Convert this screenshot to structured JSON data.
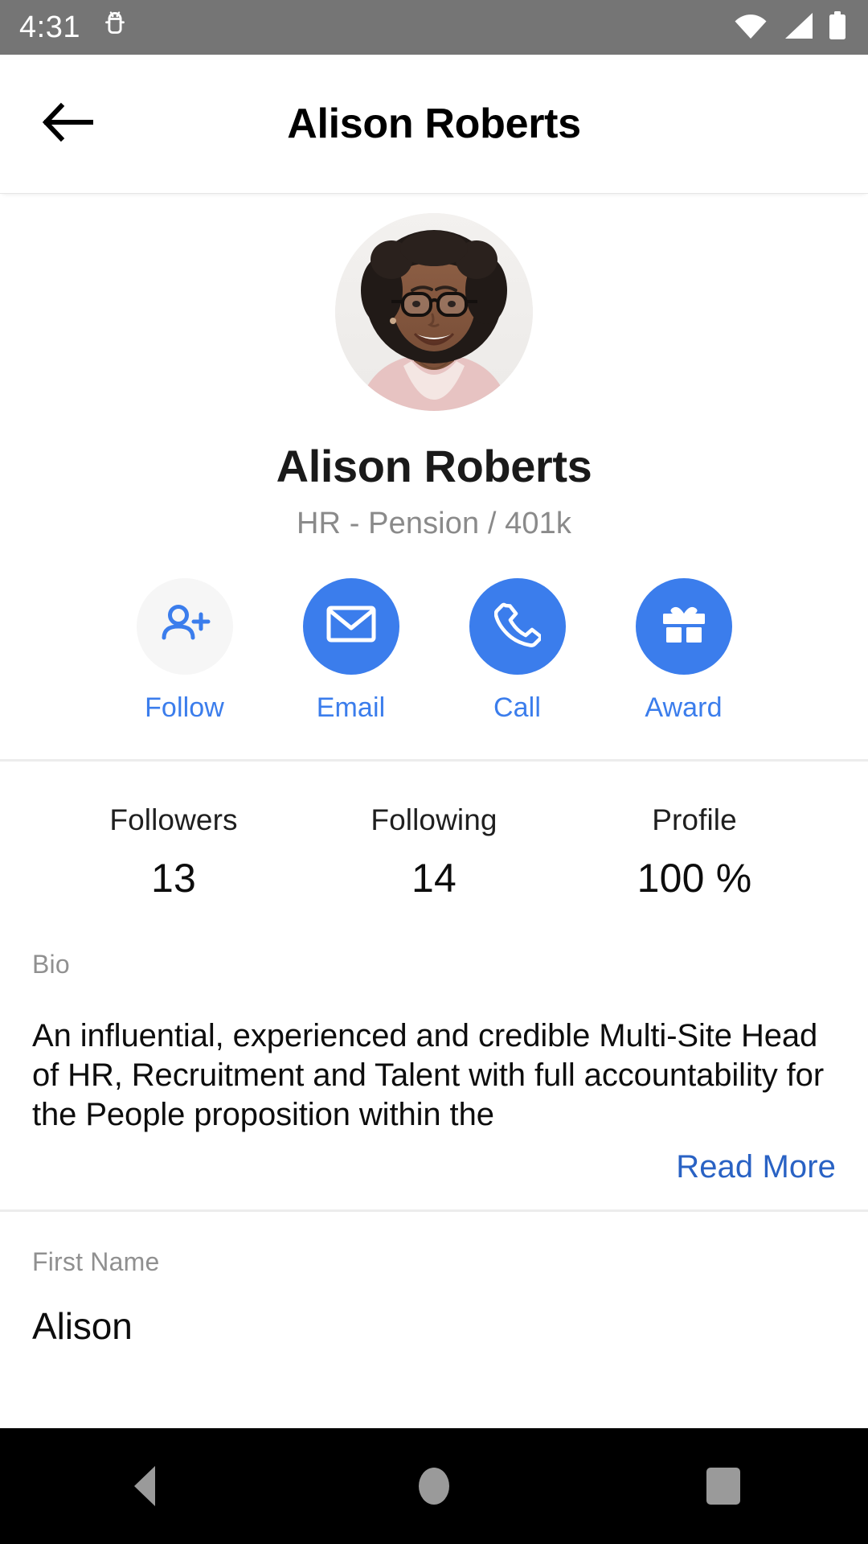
{
  "status_bar": {
    "time": "4:31",
    "icons": [
      "android-robot-icon",
      "wifi-icon",
      "cell-signal-icon",
      "battery-icon"
    ]
  },
  "app_bar": {
    "back_icon": "arrow-left-icon",
    "title": "Alison Roberts"
  },
  "profile": {
    "avatar_alt": "Alison Roberts profile photo",
    "name": "Alison Roberts",
    "subtitle": "HR - Pension / 401k"
  },
  "actions": [
    {
      "label": "Follow",
      "icon": "person-add-icon",
      "style": "ghost"
    },
    {
      "label": "Email",
      "icon": "envelope-icon",
      "style": "filled"
    },
    {
      "label": "Call",
      "icon": "phone-icon",
      "style": "filled"
    },
    {
      "label": "Award",
      "icon": "gift-icon",
      "style": "filled"
    }
  ],
  "stats": [
    {
      "label": "Followers",
      "value": "13"
    },
    {
      "label": "Following",
      "value": "14"
    },
    {
      "label": "Profile",
      "value": "100 %"
    }
  ],
  "bio": {
    "label": "Bio",
    "text": "An influential, experienced and credible Multi-Site Head of HR, Recruitment and Talent with full accountability for the People proposition within the",
    "read_more": "Read More"
  },
  "first_name": {
    "label": "First Name",
    "value": "Alison"
  },
  "nav_bar": {
    "back": "nav-back-icon",
    "home": "nav-home-icon",
    "recents": "nav-recents-icon"
  },
  "colors": {
    "accent": "#3b7dec",
    "link": "#2962c4",
    "status_bar": "#757575",
    "muted_text": "#8a8a8a"
  }
}
